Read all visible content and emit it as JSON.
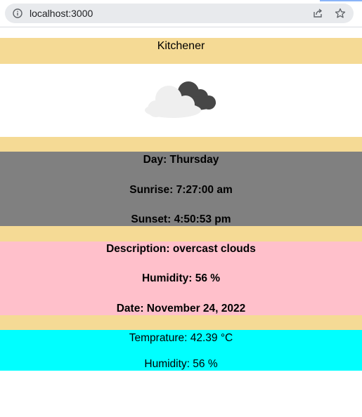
{
  "browser": {
    "url": "localhost:3000"
  },
  "weather": {
    "city": "Kitchener",
    "day_line": "Day: Thursday",
    "sunrise_line": "Sunrise: 7:27:00 am",
    "sunset_line": "Sunset: 4:50:53 pm",
    "description_line": "Description: overcast clouds",
    "humidity_line_bold": "Humidity: 56 %",
    "date_line": "Date: November 24, 2022",
    "temperature_line": "Temprature: 42.39 °C",
    "humidity_line": "Humidity: 56 %"
  },
  "icons": {
    "info": "info-icon",
    "share": "share-icon",
    "star": "star-icon",
    "weather": "overcast-clouds-icon"
  },
  "colors": {
    "band_yellow": "#f5da95",
    "band_gray": "#808080",
    "band_pink": "#ffc0cb",
    "band_cyan": "#00ffff"
  }
}
